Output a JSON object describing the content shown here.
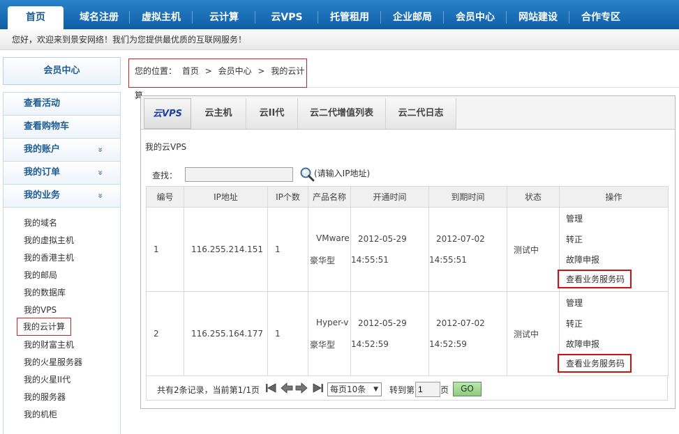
{
  "nav": {
    "items": [
      "首页",
      "域名注册",
      "虚拟主机",
      "云计算",
      "云VPS",
      "托管租用",
      "企业邮局",
      "会员中心",
      "网站建设",
      "合作专区"
    ],
    "active_index": 0
  },
  "welcome_text": "您好，欢迎来到景安网络！我们为您提供最优质的互联网服务！",
  "sidebar": {
    "header": "会员中心",
    "menu": [
      {
        "label": "查看活动",
        "expandable": false
      },
      {
        "label": "查看购物车",
        "expandable": false
      },
      {
        "label": "我的账户",
        "expandable": true
      },
      {
        "label": "我的订单",
        "expandable": true
      },
      {
        "label": "我的业务",
        "expandable": true
      }
    ],
    "expand_icon": "»",
    "subitems": [
      "我的域名",
      "我的虚拟主机",
      "我的香港主机",
      "我的邮局",
      "我的数据库",
      "我的VPS",
      "我的云计算",
      "我的财富主机",
      "我的火星服务器",
      "我的火星II代",
      "我的服务器",
      "我的机柜"
    ],
    "highlighted_subitem": "我的云计算"
  },
  "breadcrumb": {
    "prefix": "您的位置：",
    "items": [
      "首页",
      "会员中心",
      "我的云计算"
    ],
    "separator": ">"
  },
  "tabs": {
    "items": [
      "云VPS",
      "云主机",
      "云II代",
      "云二代增值列表",
      "云二代日志"
    ],
    "active_index": 0
  },
  "panel_title": "我的云VPS",
  "search": {
    "label": "查找：",
    "value": "",
    "hint": "(请输入IP地址)"
  },
  "table": {
    "headers": [
      "编号",
      "IP地址",
      "IP个数",
      "产品名称",
      "开通时间",
      "到期时间",
      "状态",
      "操作"
    ],
    "rows": [
      {
        "num": "1",
        "ip": "116.255.214.151",
        "ip_count": "1",
        "product_l1": "VMware",
        "product_l2": "豪华型",
        "open_date": "2012-05-29",
        "open_time": "14:55:51",
        "expire_date": "2012-07-02",
        "expire_time": "14:55:51",
        "status": "测试中",
        "ops": [
          "管理",
          "转正",
          "故障申报",
          "查看业务服务码"
        ]
      },
      {
        "num": "2",
        "ip": "116.255.164.177",
        "ip_count": "1",
        "product_l1": "Hyper-v",
        "product_l2": "豪华型",
        "open_date": "2012-05-29",
        "open_time": "14:52:59",
        "expire_date": "2012-07-02",
        "expire_time": "14:52:59",
        "status": "测试中",
        "ops": [
          "管理",
          "转正",
          "故障申报",
          "查看业务服务码"
        ]
      }
    ]
  },
  "pager": {
    "summary": "共有2条记录，当前第1/1页",
    "page_size": "每页10条",
    "goto_prefix": "转到第",
    "goto_value": "1",
    "goto_suffix": "页",
    "go_label": "GO"
  },
  "colors": {
    "nav_bg": "#1569b3",
    "link_blue": "#1d5d93",
    "status_red": "#c8000a",
    "highlight_red": "#cc2222"
  }
}
